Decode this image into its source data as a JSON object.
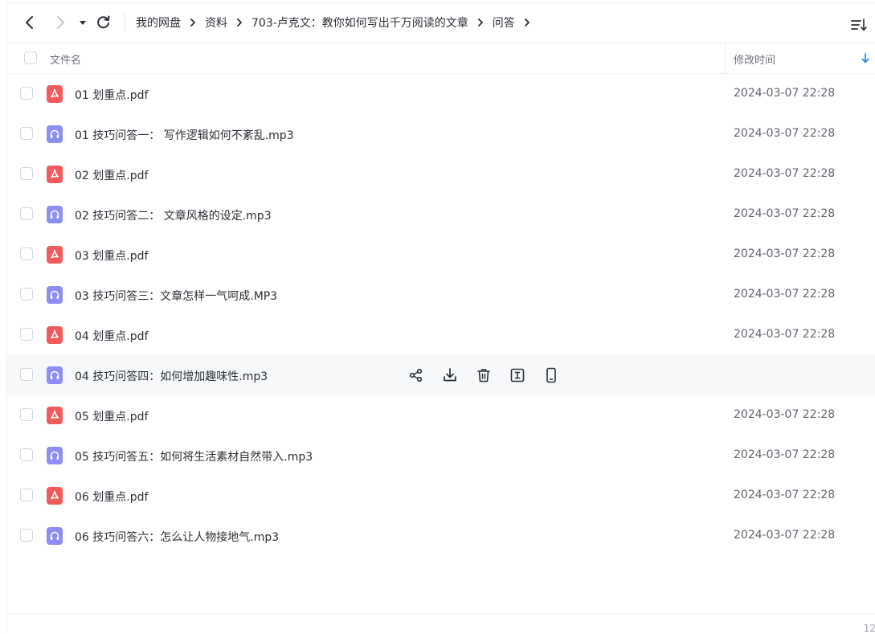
{
  "toolbar": {
    "back_icon": "chevron-left-icon",
    "forward_icon": "chevron-right-icon",
    "history_icon": "caret-down-icon",
    "refresh_icon": "refresh-icon",
    "sort_icon": "sort-list-icon"
  },
  "breadcrumb": [
    "我的网盘",
    "资料",
    "703-卢克文：教你如何写出千万阅读的文章",
    "问答"
  ],
  "columns": {
    "name": "文件名",
    "modified": "修改时间"
  },
  "files": [
    {
      "name": "01 划重点.pdf",
      "type": "pdf",
      "modified": "2024-03-07 22:28"
    },
    {
      "name": "01 技巧问答一：  写作逻辑如何不紊乱.mp3",
      "type": "mp3",
      "modified": "2024-03-07 22:28"
    },
    {
      "name": "02 划重点.pdf",
      "type": "pdf",
      "modified": "2024-03-07 22:28"
    },
    {
      "name": "02 技巧问答二：  文章风格的设定.mp3",
      "type": "mp3",
      "modified": "2024-03-07 22:28"
    },
    {
      "name": "03 划重点.pdf",
      "type": "pdf",
      "modified": "2024-03-07 22:28"
    },
    {
      "name": "03 技巧问答三：文章怎样一气呵成.MP3",
      "type": "mp3",
      "modified": "2024-03-07 22:28"
    },
    {
      "name": "04 划重点.pdf",
      "type": "pdf",
      "modified": "2024-03-07 22:28"
    },
    {
      "name": "04 技巧问答四：如何增加趣味性.mp3",
      "type": "mp3",
      "modified": "",
      "hovered": true
    },
    {
      "name": "05 划重点.pdf",
      "type": "pdf",
      "modified": "2024-03-07 22:28"
    },
    {
      "name": "05 技巧问答五：如何将生活素材自然带入.mp3",
      "type": "mp3",
      "modified": "2024-03-07 22:28"
    },
    {
      "name": "06 划重点.pdf",
      "type": "pdf",
      "modified": "2024-03-07 22:28"
    },
    {
      "name": "06 技巧问答六：怎么让人物接地气.mp3",
      "type": "mp3",
      "modified": "2024-03-07 22:28"
    }
  ],
  "row_actions": [
    "share-icon",
    "download-icon",
    "delete-icon",
    "rename-icon",
    "phone-icon"
  ],
  "footer": {
    "count": "12"
  },
  "colors": {
    "pdf": "#f25b5b",
    "mp3": "#8b8ef5",
    "accent": "#2d8cf0"
  }
}
